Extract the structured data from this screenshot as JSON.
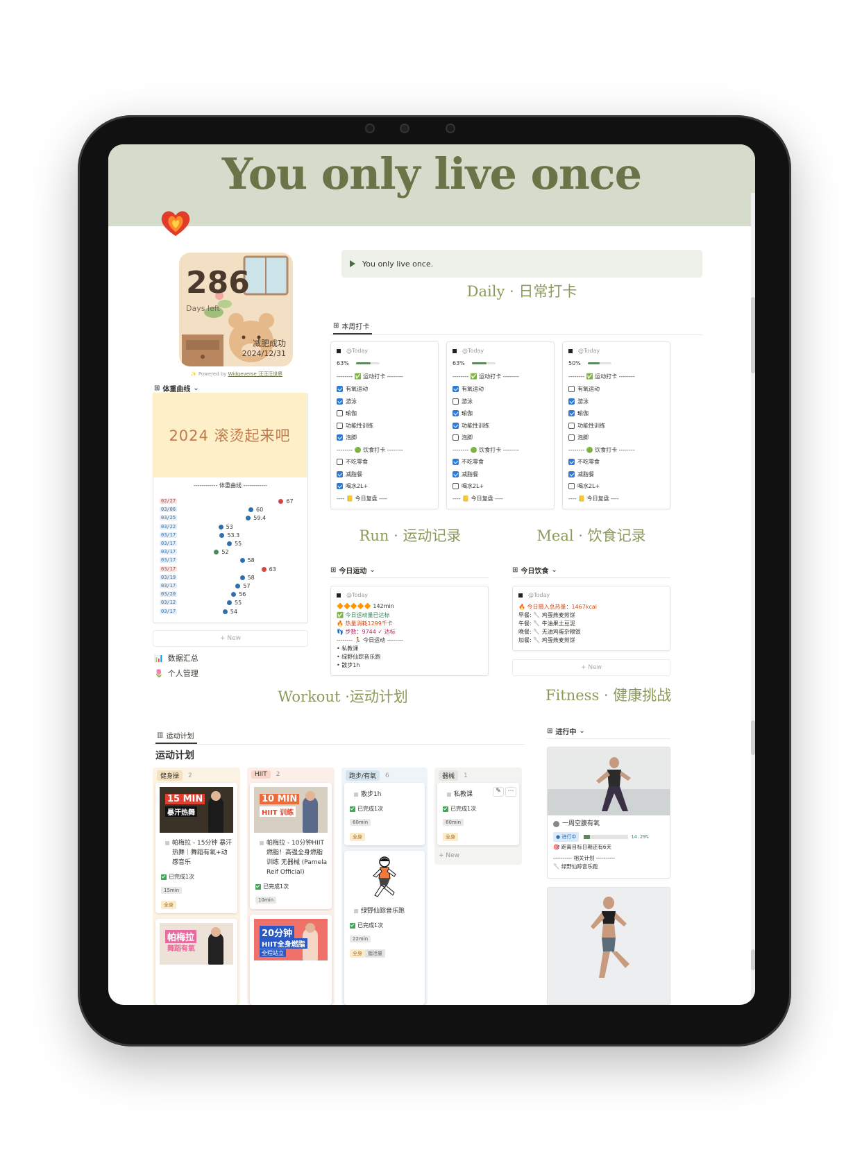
{
  "banner": {
    "title": "You only live once"
  },
  "widget": {
    "days": "286",
    "days_label": "Days left",
    "goal": "减肥成功",
    "date": "2024/12/31",
    "powered_prefix": "✨ Powered by ",
    "powered_link": "Widgeverse 汪汪汪世界"
  },
  "weight": {
    "view_label": "体重曲线",
    "banner_text": "2024 滚烫起来吧",
    "divider_text": "------------ 体重曲线 ------------",
    "new_label": "+ New",
    "points": [
      {
        "date": "02/27",
        "value": 67,
        "color": "#d64545",
        "date_color": "#c0392b"
      },
      {
        "date": "03/06",
        "value": 60,
        "color": "#2f6fae",
        "date_color": "#2f6fae"
      },
      {
        "date": "03/25",
        "value": 59.4,
        "color": "#2f6fae",
        "date_color": "#2f6fae"
      },
      {
        "date": "03/22",
        "value": 53,
        "color": "#2f6fae",
        "date_color": "#2f6fae"
      },
      {
        "date": "03/17",
        "value": 53.3,
        "color": "#2f6fae",
        "date_color": "#2f6fae"
      },
      {
        "date": "03/17",
        "value": 55,
        "color": "#2f6fae",
        "date_color": "#2f6fae"
      },
      {
        "date": "03/17",
        "value": 52,
        "color": "#4f8a5b",
        "date_color": "#2f6fae"
      },
      {
        "date": "03/17",
        "value": 58,
        "color": "#2f6fae",
        "date_color": "#2f6fae"
      },
      {
        "date": "03/17",
        "value": 63,
        "color": "#d64545",
        "date_color": "#c0392b"
      },
      {
        "date": "03/19",
        "value": 58,
        "color": "#2f6fae",
        "date_color": "#2f6fae"
      },
      {
        "date": "03/17",
        "value": 57,
        "color": "#2f6fae",
        "date_color": "#2f6fae"
      },
      {
        "date": "03/20",
        "value": 56,
        "color": "#2f6fae",
        "date_color": "#2f6fae"
      },
      {
        "date": "03/12",
        "value": 55,
        "color": "#2f6fae",
        "date_color": "#2f6fae"
      },
      {
        "date": "03/17",
        "value": 54,
        "color": "#2f6fae",
        "date_color": "#2f6fae"
      }
    ]
  },
  "links": [
    {
      "icon": "📊",
      "label": "数据汇总"
    },
    {
      "icon": "🌷",
      "label": "个人管理"
    }
  ],
  "callout": {
    "text": "You only live once."
  },
  "daily": {
    "title": "Daily · 日常打卡",
    "view_label": "本周打卡",
    "cards": [
      {
        "today": "@Today",
        "percent": "63%",
        "fraction": 0.63,
        "sport_header": "-------- ✅ 运动打卡 --------",
        "items": [
          {
            "label": "有氧运动",
            "checked": true
          },
          {
            "label": "游泳",
            "checked": true
          },
          {
            "label": "瑜伽",
            "checked": false
          },
          {
            "label": "功能性训练",
            "checked": false
          },
          {
            "label": "泡脚",
            "checked": true
          }
        ],
        "diet_header": "-------- 🟢 饮食打卡 --------",
        "diet": [
          {
            "label": "不吃零食",
            "checked": false
          },
          {
            "label": "减脂餐",
            "checked": true
          },
          {
            "label": "喝水2L+",
            "checked": true
          }
        ],
        "review": "---- 📒 今日复盘 ----"
      },
      {
        "today": "@Today",
        "percent": "63%",
        "fraction": 0.63,
        "sport_header": "-------- ✅ 运动打卡 --------",
        "items": [
          {
            "label": "有氧运动",
            "checked": true
          },
          {
            "label": "游泳",
            "checked": false
          },
          {
            "label": "瑜伽",
            "checked": true
          },
          {
            "label": "功能性训练",
            "checked": true
          },
          {
            "label": "泡脚",
            "checked": false
          }
        ],
        "diet_header": "-------- 🟢 饮食打卡 --------",
        "diet": [
          {
            "label": "不吃零食",
            "checked": true
          },
          {
            "label": "减脂餐",
            "checked": true
          },
          {
            "label": "喝水2L+",
            "checked": false
          }
        ],
        "review": "---- 📒 今日复盘 ----"
      },
      {
        "today": "@Today",
        "percent": "50%",
        "fraction": 0.5,
        "sport_header": "-------- ✅ 运动打卡 --------",
        "items": [
          {
            "label": "有氧运动",
            "checked": false
          },
          {
            "label": "游泳",
            "checked": true
          },
          {
            "label": "瑜伽",
            "checked": true
          },
          {
            "label": "功能性训练",
            "checked": false
          },
          {
            "label": "泡脚",
            "checked": false
          }
        ],
        "diet_header": "-------- 🟢 饮食打卡 --------",
        "diet": [
          {
            "label": "不吃零食",
            "checked": true
          },
          {
            "label": "减脂餐",
            "checked": true
          },
          {
            "label": "喝水2L+",
            "checked": false
          }
        ],
        "review": "---- 📒 今日复盘 ----"
      }
    ]
  },
  "run": {
    "title": "Run · 运动记录",
    "view_label": "今日运动",
    "today": "@Today",
    "lines": [
      {
        "text": "🔶🔶🔶🔶🔶 142min",
        "color": "#37352f"
      },
      {
        "text": "✅ 今日运动量已达标",
        "color": "#2e8b57"
      },
      {
        "text": "🔥 热量消耗1299千卡",
        "color": "#d9480f"
      },
      {
        "text": "👣 步数：9744 ✓ 达标",
        "color": "#c2255c"
      },
      {
        "text": "-------- 🏃 今日运动 --------",
        "color": "#37352f"
      },
      {
        "text": "• 私教课",
        "color": "#37352f"
      },
      {
        "text": "• 绿野仙踪音乐跑",
        "color": "#37352f"
      },
      {
        "text": "• 散步1h",
        "color": "#37352f"
      }
    ]
  },
  "meal": {
    "title": "Meal · 饮食记录",
    "view_label": "今日饮食",
    "today": "@Today",
    "lines": [
      {
        "text": "🔥 今日摄入总热量：1467kcal",
        "color": "#d9480f"
      },
      {
        "text": "早餐: 🥄 鸡蛋燕麦煎饼",
        "color": "#37352f"
      },
      {
        "text": "午餐: 🥄 牛油果土豆泥",
        "color": "#37352f"
      },
      {
        "text": "晚餐: 🥄 无油鸡蛋杂粮饭",
        "color": "#37352f"
      },
      {
        "text": "加餐: 🥄 鸡蛋燕麦煎饼",
        "color": "#37352f"
      }
    ],
    "new_label": "+ New"
  },
  "workout": {
    "title": "Workout ·运动计划",
    "view_label": "运动计划",
    "heading": "运动计划",
    "columns": [
      {
        "name": "健身操",
        "count": "2",
        "bg": "#fbf3e4",
        "pill": "#f5e1c0"
      },
      {
        "name": "HIIT",
        "count": "2",
        "bg": "#fcefe9",
        "pill": "#f8d6c8"
      },
      {
        "name": "跑步/有氧",
        "count": "6",
        "bg": "#eef4f7",
        "pill": "#d3e5ef"
      },
      {
        "name": "器械",
        "count": "1",
        "bg": "#f3f3f1",
        "pill": "#e6e5e2"
      }
    ],
    "cards": {
      "aerobic1": {
        "overlay": "15 MIN",
        "overlay2": "暴汗热舞",
        "title": "帕梅拉 - 15分钟 暴汗热舞｜舞蹈有氧+动感音乐",
        "done": "已完成1次",
        "dur": "15min",
        "body": "全身"
      },
      "hiit1": {
        "overlay": "10 MIN",
        "overlay2": "HIIT 训练",
        "title": "帕梅拉 - 10分钟HIIT燃脂！高强全身燃脂训练 无器械 (Pamela Reif Official)",
        "done": "已完成1次",
        "dur": "10min",
        "body": "全身"
      },
      "run1": {
        "title": "散步1h",
        "done": "已完成1次",
        "dur": "60min",
        "body": "全身"
      },
      "run2": {
        "title": "绿野仙踪音乐跑",
        "done": "已完成1次",
        "dur": "22min",
        "body": "全身",
        "extra": "脂活量"
      },
      "gym1": {
        "title": "私教课",
        "done": "已完成1次",
        "dur": "60min",
        "body": "全身"
      },
      "aerobic2": {
        "overlay": "帕梅拉",
        "overlay2": "舞蹈有氧"
      },
      "hiit2": {
        "overlay": "20分钟",
        "overlay2": "HIIT全身燃脂",
        "overlay3": "全程站立"
      }
    },
    "new_label": "+ New"
  },
  "fitness": {
    "title": "Fitness · 健康挑战",
    "view_label": "进行中",
    "card": {
      "name": "一周空腹有氧",
      "status": "进行中",
      "progress": "14.29%",
      "progress_value": 0.1429,
      "deadline": "距离目标日期还有6天",
      "plan_header": "---------- 相关计划 ----------",
      "plan": "绿野仙踪音乐跑"
    }
  }
}
